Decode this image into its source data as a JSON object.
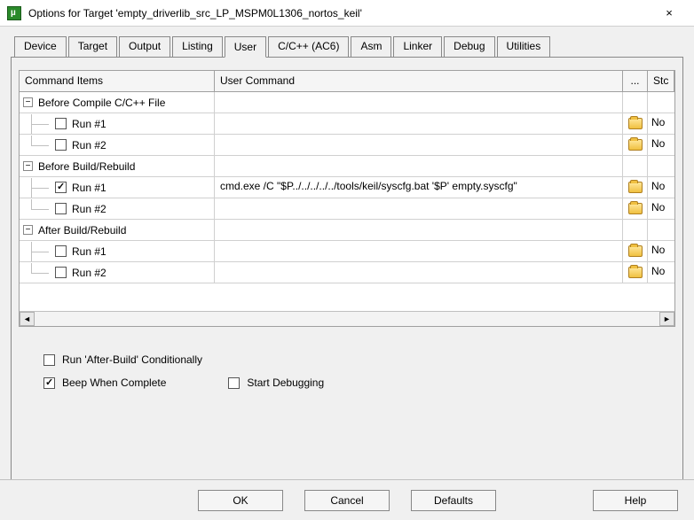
{
  "window": {
    "title": "Options for Target 'empty_driverlib_src_LP_MSPM0L1306_nortos_keil'",
    "close": "×"
  },
  "tabs": [
    "Device",
    "Target",
    "Output",
    "Listing",
    "User",
    "C/C++ (AC6)",
    "Asm",
    "Linker",
    "Debug",
    "Utilities"
  ],
  "active_tab": "User",
  "grid": {
    "headers": {
      "items": "Command Items",
      "cmd": "User Command",
      "dots": "...",
      "stc": "Stc"
    },
    "groups": [
      {
        "label": "Before Compile C/C++ File",
        "rows": [
          {
            "label": "Run #1",
            "checked": false,
            "cmd": "",
            "browse": true,
            "stc": "No"
          },
          {
            "label": "Run #2",
            "checked": false,
            "cmd": "",
            "browse": true,
            "stc": "No"
          }
        ]
      },
      {
        "label": "Before Build/Rebuild",
        "rows": [
          {
            "label": "Run #1",
            "checked": true,
            "cmd": "cmd.exe /C \"$P../../../../../tools/keil/syscfg.bat '$P' empty.syscfg\"",
            "browse": true,
            "stc": "No"
          },
          {
            "label": "Run #2",
            "checked": false,
            "cmd": "",
            "browse": true,
            "stc": "No"
          }
        ]
      },
      {
        "label": "After Build/Rebuild",
        "rows": [
          {
            "label": "Run #1",
            "checked": false,
            "cmd": "",
            "browse": true,
            "stc": "No"
          },
          {
            "label": "Run #2",
            "checked": false,
            "cmd": "",
            "browse": true,
            "stc": "No"
          }
        ]
      }
    ]
  },
  "options": {
    "run_after_build_cond": {
      "label": "Run 'After-Build' Conditionally",
      "checked": false
    },
    "beep": {
      "label": "Beep When Complete",
      "checked": true
    },
    "start_dbg": {
      "label": "Start Debugging",
      "checked": false
    }
  },
  "buttons": {
    "ok": "OK",
    "cancel": "Cancel",
    "defaults": "Defaults",
    "help": "Help"
  }
}
